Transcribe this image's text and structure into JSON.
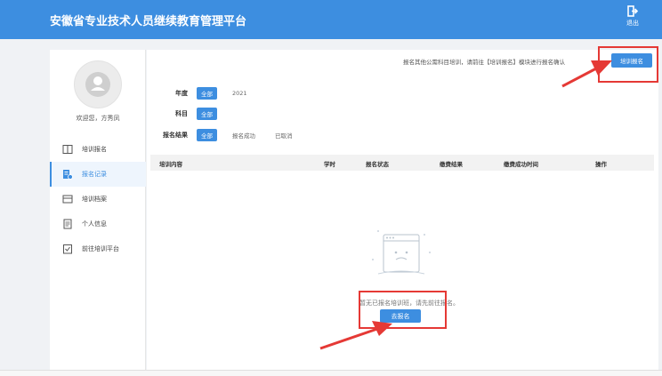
{
  "header": {
    "title": "安徽省专业技术人员继续教育管理平台",
    "logout_label": "退出"
  },
  "sidebar": {
    "welcome": "欢迎您，方秀凤",
    "items": [
      {
        "label": "培训报名",
        "icon": "book-icon"
      },
      {
        "label": "报名记录",
        "icon": "record-icon"
      },
      {
        "label": "培训档案",
        "icon": "archive-icon"
      },
      {
        "label": "个人信息",
        "icon": "profile-icon"
      },
      {
        "label": "前往培训平台",
        "icon": "clipboard-icon"
      }
    ],
    "active_index": 1
  },
  "main": {
    "notice": "报名其他公需科目培训，请前往【培训报名】模块进行报名确认",
    "register_button": "培训报名",
    "filters": {
      "year": {
        "label": "年度",
        "options": [
          "全部",
          "2021"
        ]
      },
      "subject": {
        "label": "科目",
        "options": [
          "全部"
        ]
      },
      "result": {
        "label": "报名结果",
        "options": [
          "全部",
          "报名成功",
          "已取消"
        ]
      }
    },
    "table_headers": [
      "培训内容",
      "学时",
      "报名状态",
      "缴费结果",
      "缴费成功时间",
      "操作"
    ],
    "empty_text": "暂无已报名培训班，请先前往报名。",
    "go_button": "去报名"
  },
  "colors": {
    "primary": "#3d8ee0",
    "highlight": "#e53935"
  }
}
